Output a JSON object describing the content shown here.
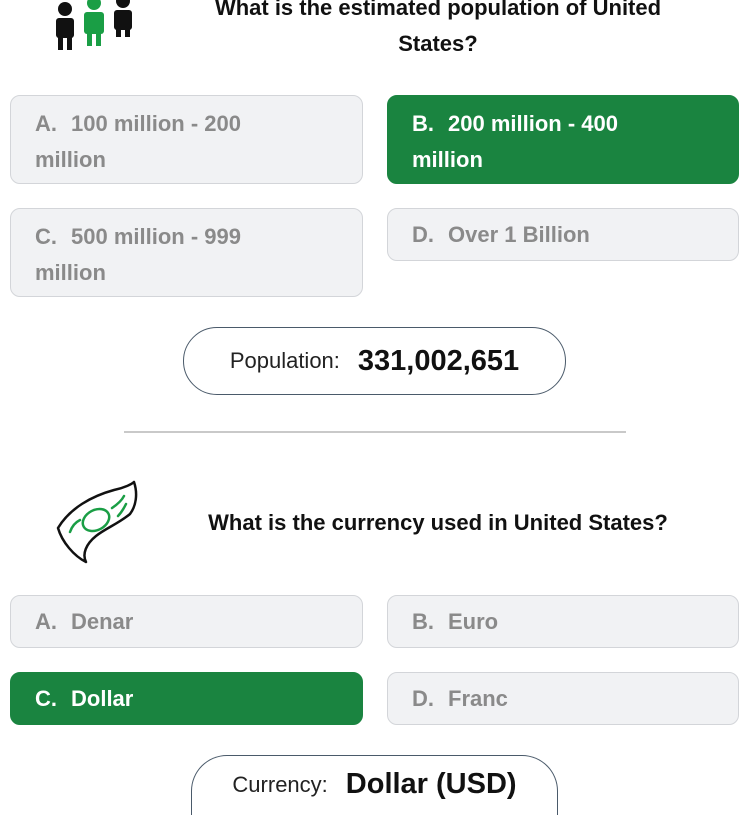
{
  "q1": {
    "title_line1": "What is the estimated population of United",
    "title_line2": "States?",
    "options": [
      {
        "letter": "A.",
        "line1": "100 million - 200",
        "line2": "million",
        "selected": false
      },
      {
        "letter": "B.",
        "line1": "200 million - 400",
        "line2": "million",
        "selected": true
      },
      {
        "letter": "C.",
        "line1": "500 million - 999",
        "line2": "million",
        "selected": false
      },
      {
        "letter": "D.",
        "line1": "Over 1 Billion",
        "line2": "",
        "selected": false
      }
    ],
    "answer_label": "Population:",
    "answer_value": "331,002,651"
  },
  "q2": {
    "title": "What is the currency used in United States?",
    "options": [
      {
        "letter": "A.",
        "label": "Denar",
        "selected": false
      },
      {
        "letter": "B.",
        "label": "Euro",
        "selected": false
      },
      {
        "letter": "C.",
        "label": "Dollar",
        "selected": true
      },
      {
        "letter": "D.",
        "label": "Franc",
        "selected": false
      }
    ],
    "answer_label": "Currency:",
    "answer_value": "Dollar (USD)"
  },
  "colors": {
    "selected_green": "#1a8440",
    "option_bg": "#f1f2f4",
    "option_text": "#8a8a8a"
  },
  "icons": {
    "q1": "people-icon",
    "q2": "banknote-icon"
  }
}
